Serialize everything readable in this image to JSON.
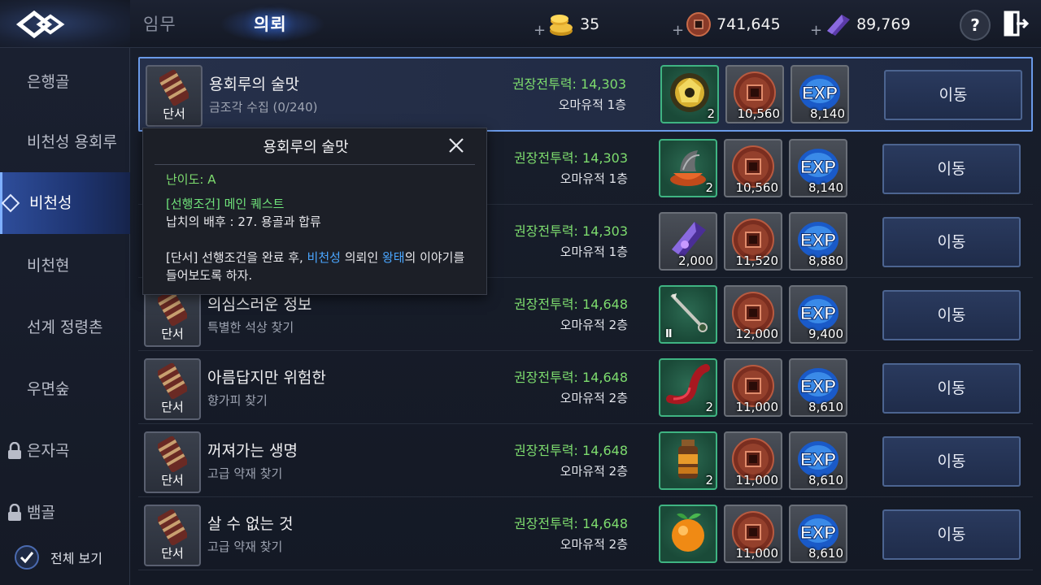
{
  "tabs": {
    "mission": "임무",
    "request": "의뢰"
  },
  "currencies": {
    "gold": "35",
    "coin": "741,645",
    "crystal": "89,769",
    "plus": "+"
  },
  "help_label": "?",
  "sidebar": {
    "items": [
      {
        "label": "은행골",
        "locked": false
      },
      {
        "label": "비천성 용회루",
        "locked": false
      },
      {
        "label": "비천성",
        "locked": false,
        "active": true
      },
      {
        "label": "비천현",
        "locked": false
      },
      {
        "label": "선계 정령촌",
        "locked": false
      },
      {
        "label": "우면숲",
        "locked": false
      },
      {
        "label": "은자곡",
        "locked": true
      },
      {
        "label": "뱀골",
        "locked": true
      }
    ],
    "view_all": "전체 보기"
  },
  "quests": [
    {
      "tag": "단서",
      "title": "용회루의 술맛",
      "sub": "금조각 수집 (0/240)",
      "power": "권장전투력: 14,303",
      "loc": "오마유적 1층",
      "rewards": [
        {
          "icon": "gold-ore-icon",
          "count": "2"
        },
        {
          "icon": "bronze-coin-icon",
          "count": "10,560"
        },
        {
          "icon": "exp-orb-icon",
          "count": "8,140"
        }
      ],
      "button": "이동"
    },
    {
      "tag": "단서",
      "title": "",
      "sub": "",
      "power": "권장전투력: 14,303",
      "loc": "오마유적 1층",
      "rewards": [
        {
          "icon": "herb-bowl-icon",
          "count": "2"
        },
        {
          "icon": "bronze-coin-icon",
          "count": "10,560"
        },
        {
          "icon": "exp-orb-icon",
          "count": "8,140"
        }
      ],
      "button": "이동"
    },
    {
      "tag": "단서",
      "title": "",
      "sub": "",
      "power": "권장전투력: 14,303",
      "loc": "오마유적 1층",
      "rewards": [
        {
          "icon": "purple-crystal-icon",
          "count": "2,000"
        },
        {
          "icon": "bronze-coin-icon",
          "count": "11,520"
        },
        {
          "icon": "exp-orb-icon",
          "count": "8,880"
        }
      ],
      "button": "이동"
    },
    {
      "tag": "단서",
      "title": "의심스러운 정보",
      "sub": "특별한 석상 찾기",
      "power": "권장전투력: 14,648",
      "loc": "오마유적 2층",
      "rewards": [
        {
          "icon": "staff-weapon-icon",
          "count": "Ⅱ"
        },
        {
          "icon": "bronze-coin-icon",
          "count": "12,000"
        },
        {
          "icon": "exp-orb-icon",
          "count": "9,400"
        }
      ],
      "button": "이동"
    },
    {
      "tag": "단서",
      "title": "아름답지만 위험한",
      "sub": "향가피 찾기",
      "power": "권장전투력: 14,648",
      "loc": "오마유적 2층",
      "rewards": [
        {
          "icon": "red-tentacle-icon",
          "count": "2"
        },
        {
          "icon": "bronze-coin-icon",
          "count": "11,000"
        },
        {
          "icon": "exp-orb-icon",
          "count": "8,610"
        }
      ],
      "button": "이동"
    },
    {
      "tag": "단서",
      "title": "꺼져가는 생명",
      "sub": "고급 약재 찾기",
      "power": "권장전투력: 14,648",
      "loc": "오마유적 2층",
      "rewards": [
        {
          "icon": "potion-jar-icon",
          "count": "2"
        },
        {
          "icon": "bronze-coin-icon",
          "count": "11,000"
        },
        {
          "icon": "exp-orb-icon",
          "count": "8,610"
        }
      ],
      "button": "이동"
    },
    {
      "tag": "단서",
      "title": "살 수 없는 것",
      "sub": "고급 약재 찾기",
      "power": "권장전투력: 14,648",
      "loc": "오마유적 2층",
      "rewards": [
        {
          "icon": "orange-fruit-icon",
          "count": ""
        },
        {
          "icon": "bronze-coin-icon",
          "count": "11,000"
        },
        {
          "icon": "exp-orb-icon",
          "count": "8,610"
        }
      ],
      "button": "이동"
    }
  ],
  "tooltip": {
    "title": "용회루의 술맛",
    "difficulty": "난이도: A",
    "precondition": "[선행조건] 메인 퀘스트",
    "prereq_detail": "납치의 배후 : 27. 용골과 합류",
    "desc_a": "[단서] 선행조건을 완료 후, ",
    "desc_hl1": "비천성",
    "desc_b": " 의뢰인 ",
    "desc_hl2": "왕태",
    "desc_c": "의 이야기를 들어보도록 하자."
  },
  "colors": {
    "power": "#7ddc6e",
    "highlight": "#4aa6ff",
    "accent": "#3c7cff"
  }
}
